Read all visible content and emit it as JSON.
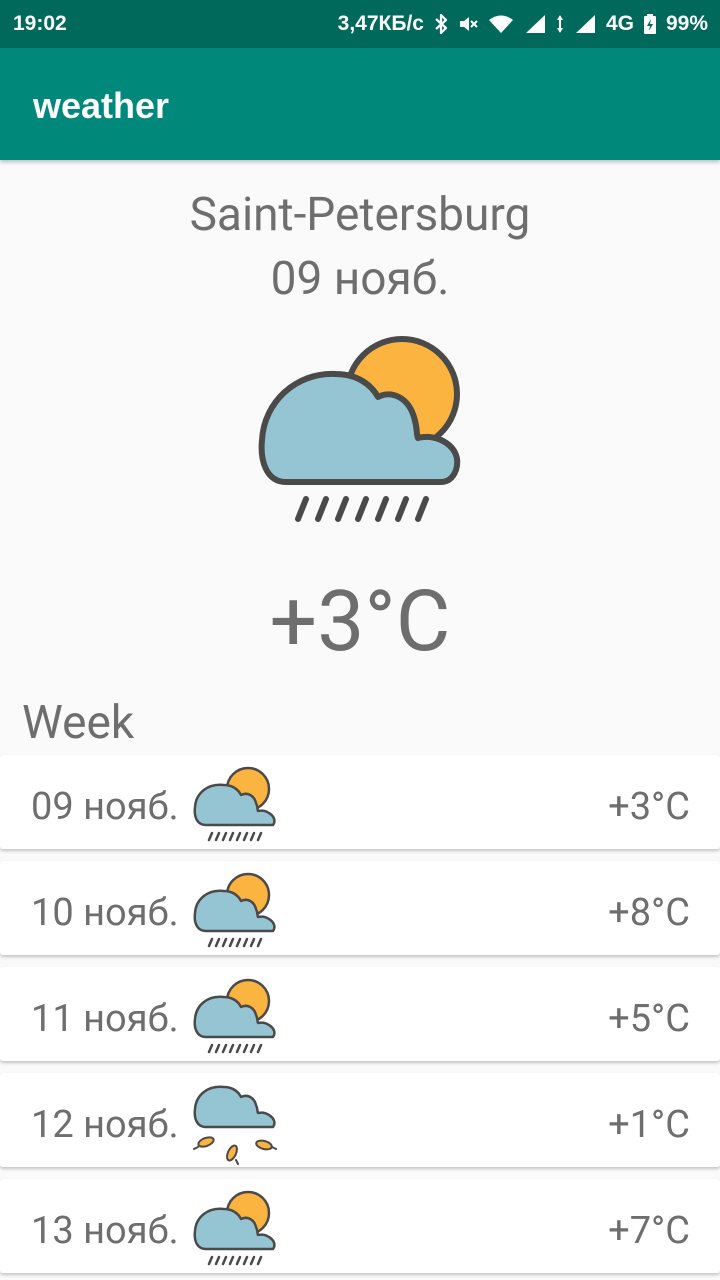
{
  "status_bar": {
    "time": "19:02",
    "network_speed": "3,47КБ/с",
    "network_type": "4G",
    "battery": "99%",
    "icons": [
      "bluetooth-icon",
      "mute-icon",
      "wifi-icon",
      "signal-icon",
      "data-arrows-icon",
      "signal-icon",
      "battery-icon"
    ]
  },
  "app_bar": {
    "title": "weather",
    "color": "#00897b"
  },
  "current": {
    "city": "Saint-Petersburg",
    "date": "09 нояб.",
    "icon": "cloud-sun-rain-icon",
    "temperature": "+3°C"
  },
  "week": {
    "label": "Week",
    "days": [
      {
        "date": "09 нояб.",
        "icon": "cloud-sun-rain-icon",
        "temperature": "+3°C"
      },
      {
        "date": "10 нояб.",
        "icon": "cloud-sun-rain-icon",
        "temperature": "+8°C"
      },
      {
        "date": "11 нояб.",
        "icon": "cloud-sun-rain-icon",
        "temperature": "+5°C"
      },
      {
        "date": "12 нояб.",
        "icon": "cloud-leaves-icon",
        "temperature": "+1°C"
      },
      {
        "date": "13 нояб.",
        "icon": "cloud-sun-rain-icon",
        "temperature": "+7°C"
      }
    ]
  },
  "colors": {
    "cloud": "#95c5d3",
    "sun": "#fcb441",
    "outline": "#4a4a4a",
    "text": "#6e6e6e"
  }
}
